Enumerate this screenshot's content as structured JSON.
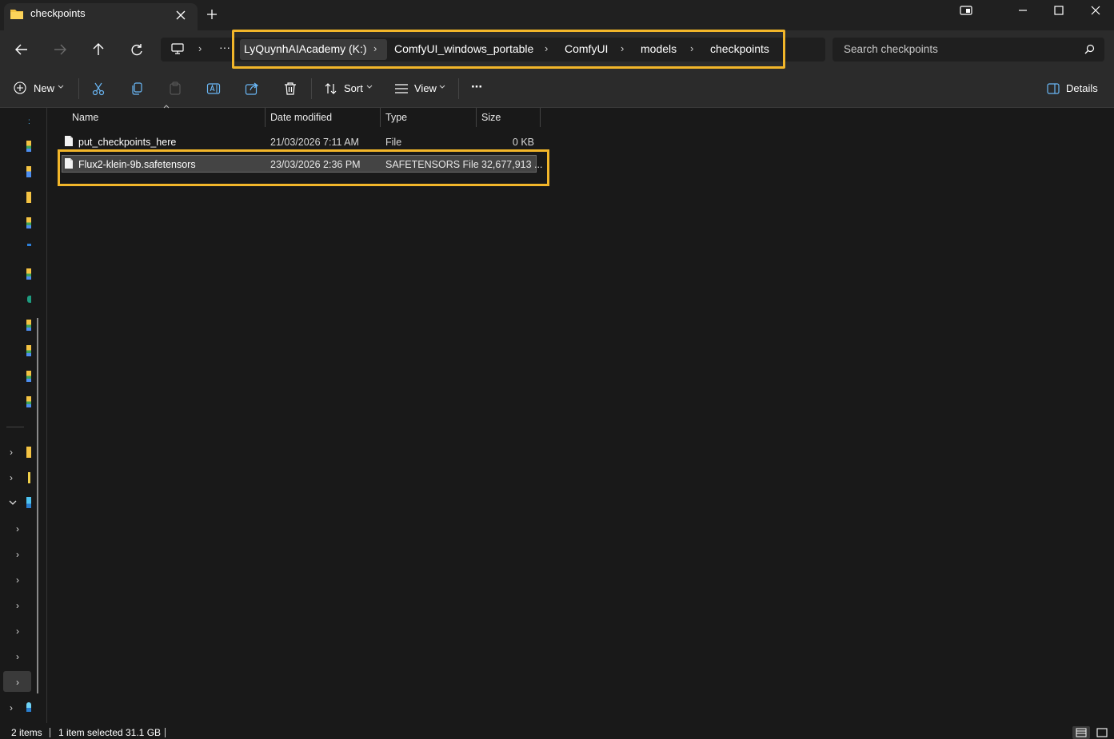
{
  "window": {
    "tab_title": "checkpoints",
    "new_tab_symbol": "+"
  },
  "address": {
    "overflow_symbol": "···",
    "crumbs": [
      "LyQuynhAIAcademy (K:)",
      "ComfyUI_windows_portable",
      "ComfyUI",
      "models",
      "checkpoints"
    ],
    "highlight_color": "#f2b62a"
  },
  "search": {
    "placeholder": "Search checkpoints"
  },
  "toolbar": {
    "new_label": "New",
    "sort_label": "Sort",
    "view_label": "View",
    "more_label": "···",
    "details_label": "Details"
  },
  "columns": {
    "name": "Name",
    "date": "Date modified",
    "type": "Type",
    "size": "Size"
  },
  "files": [
    {
      "name": "put_checkpoints_here",
      "date": "21/03/2026 7:11 AM",
      "type": "File",
      "size": "0 KB",
      "selected": false
    },
    {
      "name": "Flux2-klein-9b.safetensors",
      "date": "23/03/2026 2:36 PM",
      "type": "SAFETENSORS File",
      "size": "32,677,913 ...",
      "selected": true
    }
  ],
  "status": {
    "items": "2 items",
    "selected": "1 item selected",
    "size": "31.1 GB"
  },
  "colors": {
    "background": "#191919",
    "chrome": "#2b2b2b",
    "accent_highlight": "#f2b62a",
    "selection": "#444444"
  }
}
